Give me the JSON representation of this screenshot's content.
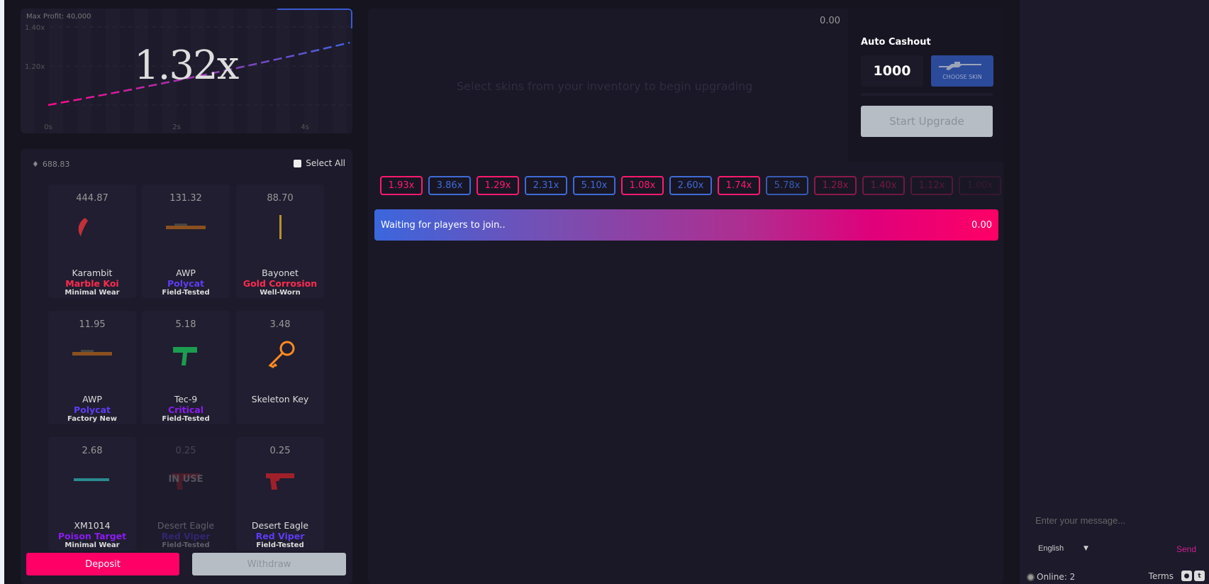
{
  "chart": {
    "max_profit": "Max Profit: 40,000",
    "multiplier": "1.32x",
    "y_ticks": [
      "1.40x",
      "1.20x"
    ],
    "x_ticks": [
      "0s",
      "2s",
      "4s"
    ],
    "current": 1.32,
    "duration_s": 4.7,
    "colors": {
      "start": "#ff0a8c",
      "end": "#3f63e0"
    }
  },
  "inventory": {
    "total": "688.83",
    "select_all": "Select All",
    "items": [
      {
        "price": "444.87",
        "name": "Karambit",
        "skin": "Marble Koi",
        "wear": "Minimal Wear",
        "color": "#ff2b4f",
        "icon": "knife-karambit"
      },
      {
        "price": "131.32",
        "name": "AWP",
        "skin": "Polycat",
        "wear": "Field-Tested",
        "color": "#5e3cf0",
        "icon": "rifle-awp"
      },
      {
        "price": "88.70",
        "name": "Bayonet",
        "skin": "Gold Corrosion",
        "wear": "Well-Worn",
        "color": "#ff2b4f",
        "icon": "knife-bayonet"
      },
      {
        "price": "11.95",
        "name": "AWP",
        "skin": "Polycat",
        "wear": "Factory New",
        "color": "#5e3cf0",
        "icon": "rifle-awp"
      },
      {
        "price": "5.18",
        "name": "Tec-9",
        "skin": "Critical",
        "wear": "Field-Tested",
        "color": "#8a1cf0",
        "icon": "smg-tec9"
      },
      {
        "price": "3.48",
        "name": "Skeleton Key",
        "skin": "",
        "wear": "",
        "color": "#ffffff",
        "icon": "key"
      },
      {
        "price": "2.68",
        "name": "XM1014",
        "skin": "Poison Target",
        "wear": "Minimal Wear",
        "color": "#8a1cf0",
        "icon": "shotgun"
      },
      {
        "price": "0.25",
        "name": "Desert Eagle",
        "skin": "Red Viper",
        "wear": "Field-Tested",
        "color": "#5e3cf0",
        "icon": "pistol",
        "in_use": "IN USE"
      },
      {
        "price": "0.25",
        "name": "Desert Eagle",
        "skin": "Red Viper",
        "wear": "Field-Tested",
        "color": "#5e3cf0",
        "icon": "pistol"
      }
    ],
    "deposit": "Deposit",
    "withdraw": "Withdraw"
  },
  "upgrade": {
    "value": "0.00",
    "hint": "Select skins from your inventory to begin upgrading",
    "auto_cashout_label": "Auto Cashout",
    "auto_cashout_value": "1000",
    "choose_skin": "CHOOSE SKIN",
    "start": "Start Upgrade"
  },
  "history": [
    {
      "v": "1.93x",
      "c": "#ff1a6e",
      "o": 1
    },
    {
      "v": "3.86x",
      "c": "#3f6ad8",
      "o": 1
    },
    {
      "v": "1.29x",
      "c": "#ff1a6e",
      "o": 1
    },
    {
      "v": "2.31x",
      "c": "#3f6ad8",
      "o": 1
    },
    {
      "v": "5.10x",
      "c": "#3f6ad8",
      "o": 1
    },
    {
      "v": "1.08x",
      "c": "#ff1a6e",
      "o": 1
    },
    {
      "v": "2.60x",
      "c": "#3f6ad8",
      "o": 1
    },
    {
      "v": "1.74x",
      "c": "#ff1a6e",
      "o": 1
    },
    {
      "v": "5.78x",
      "c": "#3f6ad8",
      "o": 0.8
    },
    {
      "v": "1.28x",
      "c": "#ff1a6e",
      "o": 0.5
    },
    {
      "v": "1.40x",
      "c": "#ff1a6e",
      "o": 0.38
    },
    {
      "v": "1.12x",
      "c": "#ff1a6e",
      "o": 0.25
    },
    {
      "v": "1.00x",
      "c": "#ff1a6e",
      "o": 0.12
    }
  ],
  "status": {
    "text": "Waiting for players to join..",
    "value": "0.00"
  },
  "chat": {
    "placeholder": "Enter your message...",
    "language": "English",
    "send": "Send",
    "online": "Online: 2",
    "terms": "Terms"
  }
}
